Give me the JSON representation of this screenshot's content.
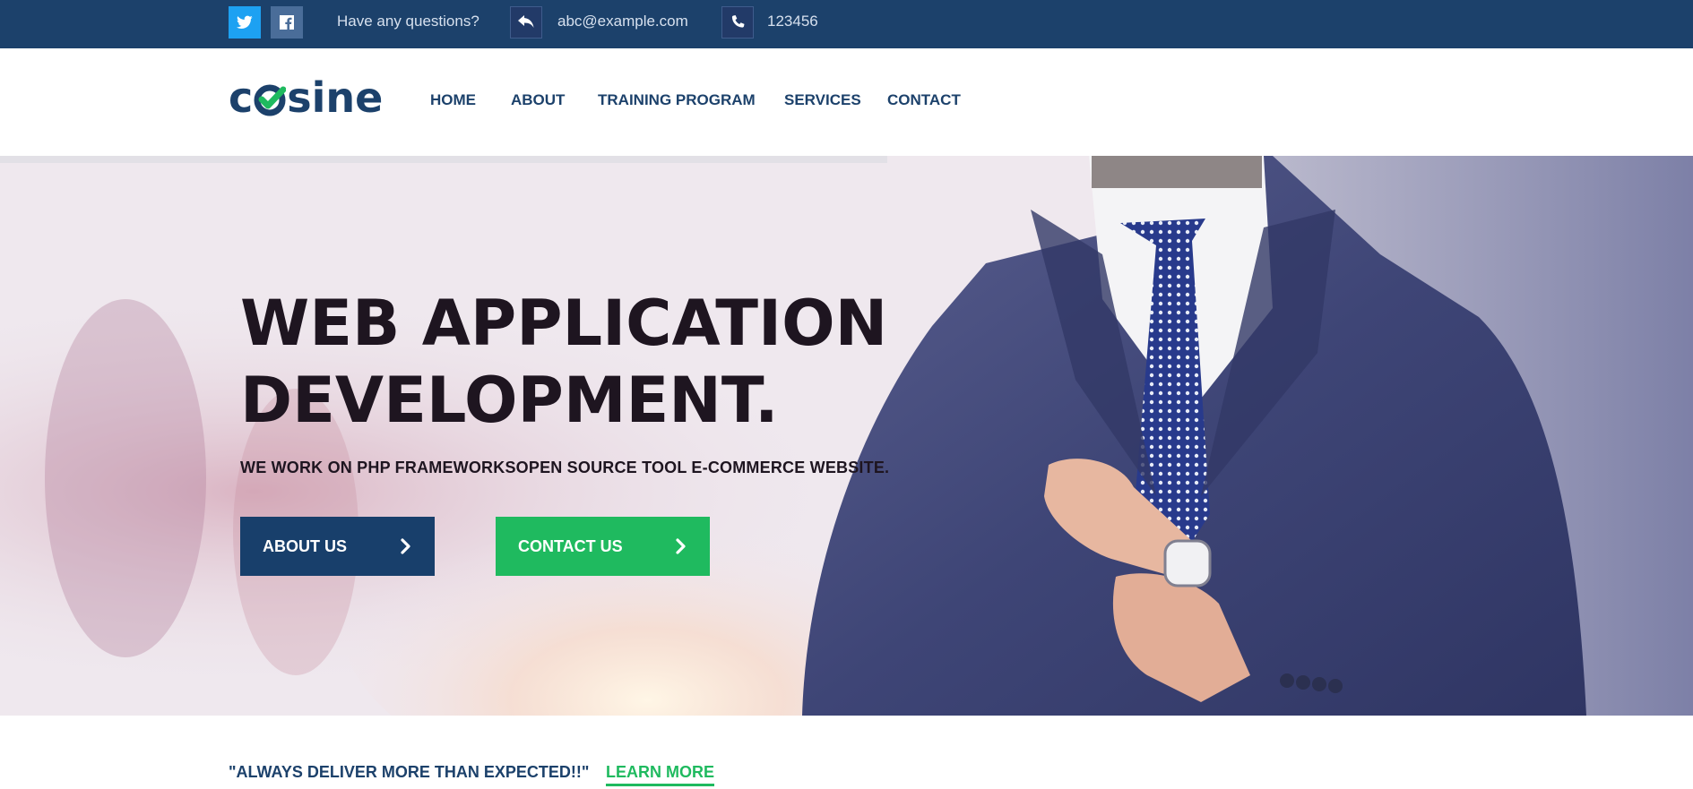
{
  "topbar": {
    "social": [
      {
        "name": "twitter-icon",
        "color": "#1da1f2"
      },
      {
        "name": "facebook-icon",
        "color": "#4a6d99"
      }
    ],
    "question_text": "Have any questions?",
    "email_icon": "reply-icon",
    "email": "abc@example.com",
    "phone_icon": "phone-icon",
    "phone": "123456"
  },
  "header": {
    "logo_text": "cosine",
    "nav": {
      "home": "HOME",
      "about": "ABOUT",
      "training": "TRAINING PROGRAM",
      "services": "SERVICES",
      "contact": "CONTACT"
    }
  },
  "hero": {
    "title_line1": "WEB APPLICATION",
    "title_line2": "DEVELOPMENT.",
    "subtitle": "WE WORK ON PHP FRAMEWORKSOPEN SOURCE TOOL E-COMMERCE WEBSITE.",
    "about_button": "ABOUT US",
    "contact_button": "CONTACT US",
    "button_icon": "chevron-right-icon"
  },
  "strip": {
    "tagline": "\"ALWAYS DELIVER MORE THAN EXPECTED!!\"",
    "learn_more": "LEARN MORE"
  },
  "colors": {
    "primary": "#1c416b",
    "accent": "#1fba5f",
    "twitter": "#1da1f2",
    "facebook": "#4a6d99"
  }
}
